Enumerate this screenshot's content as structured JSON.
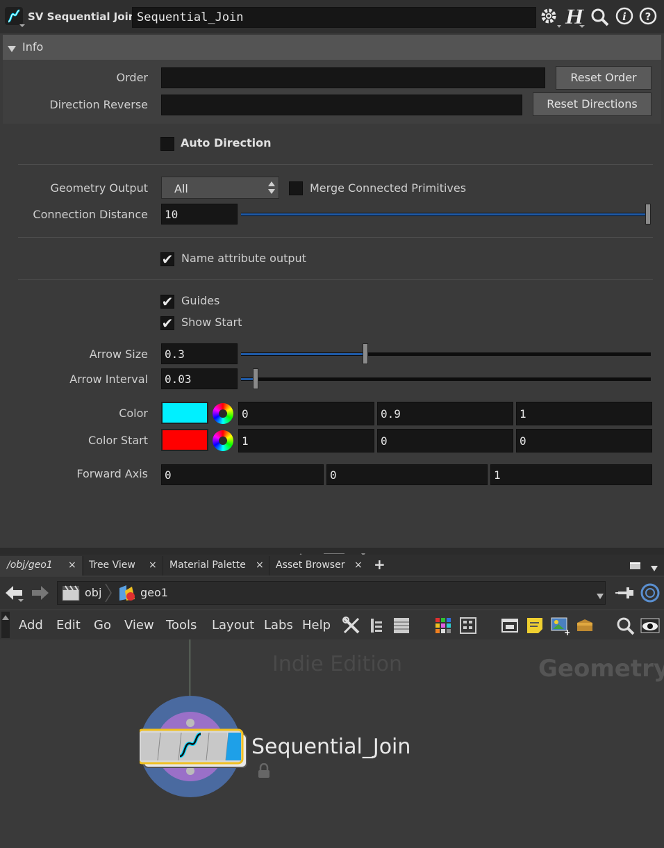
{
  "header": {
    "node_type": "SV Sequential Join",
    "node_name": "Sequential_Join"
  },
  "info": {
    "label": "Info"
  },
  "params": {
    "order": {
      "label": "Order",
      "value": "",
      "button": "Reset Order"
    },
    "direction_reverse": {
      "label": "Direction Reverse",
      "value": "",
      "button": "Reset Directions"
    },
    "auto_direction": {
      "label": "Auto Direction",
      "checked": false
    },
    "geometry_output": {
      "label": "Geometry Output",
      "value": "All"
    },
    "merge_connected": {
      "label": "Merge Connected Primitives",
      "checked": false
    },
    "connection_distance": {
      "label": "Connection Distance",
      "value": "10",
      "slider_fraction": 1.0
    },
    "name_attribute": {
      "label": "Name attribute output",
      "checked": true
    },
    "guides": {
      "label": "Guides",
      "checked": true
    },
    "show_start": {
      "label": "Show Start",
      "checked": true
    },
    "arrow_size": {
      "label": "Arrow Size",
      "value": "0.3",
      "slider_fraction": 0.3
    },
    "arrow_interval": {
      "label": "Arrow Interval",
      "value": "0.03",
      "slider_fraction": 0.03
    },
    "color": {
      "label": "Color",
      "swatch": "#00f0ff",
      "r": "0",
      "g": "0.9",
      "b": "1"
    },
    "color_start": {
      "label": "Color Start",
      "swatch": "#ff0000",
      "r": "1",
      "g": "0",
      "b": "0"
    },
    "forward_axis": {
      "label": "Forward Axis",
      "x": "0",
      "y": "0",
      "z": "1"
    }
  },
  "tabs": [
    {
      "label": "/obj/geo1"
    },
    {
      "label": "Tree View"
    },
    {
      "label": "Material Palette"
    },
    {
      "label": "Asset Browser"
    }
  ],
  "tab_close": "×",
  "tab_add": "+",
  "path": {
    "obj": "obj",
    "geo": "geo1"
  },
  "menu": [
    "Add",
    "Edit",
    "Go",
    "View",
    "Tools",
    "Layout",
    "Labs",
    "Help"
  ],
  "network": {
    "watermark": "Indie Edition",
    "context": "Geometry",
    "node_label": "Sequential_Join"
  },
  "icons": {
    "gear": "gear-icon",
    "houdini": "h-icon",
    "search": "search-icon",
    "info": "info-icon",
    "help": "help-icon",
    "lock": "lock-icon"
  }
}
